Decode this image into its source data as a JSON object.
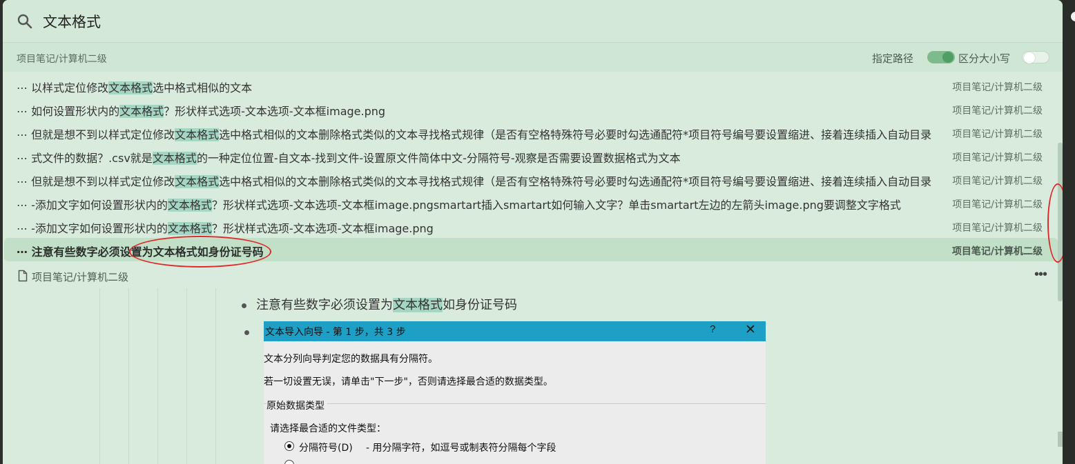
{
  "search": {
    "query": "文本格式"
  },
  "path_bar": {
    "current_path": "项目笔记/计算机二级",
    "option_path_label": "指定路径",
    "option_path_enabled": true,
    "option_case_label": "区分大小写",
    "option_case_enabled": false
  },
  "results": [
    {
      "pre": "以样式定位修改",
      "match": "文本格式",
      "post": "选中格式相似的文本",
      "path": "项目笔记/计算机二级"
    },
    {
      "pre": "如何设置形状内的",
      "match": "文本格式",
      "post": "？形状样式选项-文本选项-文本框image.png",
      "path": "项目笔记/计算机二级"
    },
    {
      "pre": "但就是想不到以样式定位修改",
      "match": "文本格式",
      "post": "选中格式相似的文本删除格式类似的文本寻找格式规律（是否有空格特殊符号必要时勾选通配符*项目符号编号要设置缩进、接着连续插入自动目录",
      "path": "项目笔记/计算机二级"
    },
    {
      "pre": "式文件的数据？.csv就是",
      "match": "文本格式",
      "post": "的一种定位位置-自文本-找到文件-设置原文件简体中文-分隔符号-观察是否需要设置数据格式为文本",
      "path": "项目笔记/计算机二级"
    },
    {
      "pre": "但就是想不到以样式定位修改",
      "match": "文本格式",
      "post": "选中格式相似的文本删除格式类似的文本寻找格式规律（是否有空格特殊符号必要时勾选通配符*项目符号编号要设置缩进、接着连续插入自动目录",
      "path": "项目笔记/计算机二级"
    },
    {
      "pre": "-添加文字如何设置形状内的",
      "match": "文本格式",
      "post": "？形状样式选项-文本选项-文本框image.pngsmartart插入smartart如何输入文字？单击smartart左边的左箭头image.png要调整文字格式",
      "path": "项目笔记/计算机二级"
    },
    {
      "pre": "-添加文字如何设置形状内的",
      "match": "文本格式",
      "post": "？形状样式选项-文本选项-文本框image.png",
      "path": "项目笔记/计算机二级"
    },
    {
      "pre": "注意有些数字必须设置为",
      "match": "文本格式",
      "post": "如身份证号码",
      "path": "项目笔记/计算机二级"
    }
  ],
  "preview": {
    "file_title": "项目笔记/计算机二级",
    "bullet_pre": "注意有些数字必须设置为",
    "bullet_match": "文本格式",
    "bullet_post": "如身份证号码"
  },
  "dialog": {
    "title": "文本导入向导 - 第 1 步，共 3 步",
    "help": "?",
    "line1": "文本分列向导判定您的数据具有分隔符。",
    "line2": "若一切设置无误，请单击\"下一步\"，否则请选择最合适的数据类型。",
    "group_label": "原始数据类型",
    "prompt": "请选择最合适的文件类型：",
    "option1_name": "分隔符号(D)",
    "option1_desc": "- 用分隔字符，如逗号或制表符分隔每个字段"
  },
  "icons": {
    "search": "search-icon",
    "file": "file-icon",
    "more": "more-horizontal-icon",
    "row_prefix": "collapse-line-icon",
    "close": "close-icon"
  },
  "colors": {
    "panel_bg": "#d8ebdc",
    "highlight": "#a5d6c4",
    "toggle_on": "#4f9e63",
    "dialog_title": "#1ea0c6",
    "annotation": "#e02a2a"
  }
}
